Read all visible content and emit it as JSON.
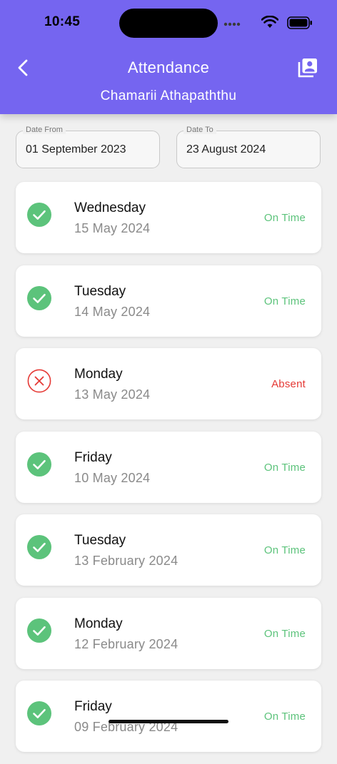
{
  "status_bar": {
    "time": "10:45"
  },
  "header": {
    "title": "Attendance",
    "subtitle": "Chamarii Athapaththu"
  },
  "filters": {
    "from": {
      "label": "Date From",
      "value": "01 September 2023"
    },
    "to": {
      "label": "Date To",
      "value": "23 August 2024"
    }
  },
  "records": [
    {
      "day": "Wednesday",
      "date": "15 May 2024",
      "status": "On Time",
      "kind": "present"
    },
    {
      "day": "Tuesday",
      "date": "14 May 2024",
      "status": "On Time",
      "kind": "present"
    },
    {
      "day": "Monday",
      "date": "13 May 2024",
      "status": "Absent",
      "kind": "absent"
    },
    {
      "day": "Friday",
      "date": "10 May 2024",
      "status": "On Time",
      "kind": "present"
    },
    {
      "day": "Tuesday",
      "date": "13 February 2024",
      "status": "On Time",
      "kind": "present"
    },
    {
      "day": "Monday",
      "date": "12 February 2024",
      "status": "On Time",
      "kind": "present"
    },
    {
      "day": "Friday",
      "date": "09 February 2024",
      "status": "On Time",
      "kind": "present"
    }
  ],
  "icons": {
    "present": "check-circle-icon",
    "absent": "x-circle-icon",
    "back": "chevron-left-icon",
    "report": "contacts-book-icon"
  },
  "colors": {
    "header": "#7565f0",
    "present": "#5cc37b",
    "on_time_text": "#5cc37b",
    "absent": "#e53935"
  }
}
